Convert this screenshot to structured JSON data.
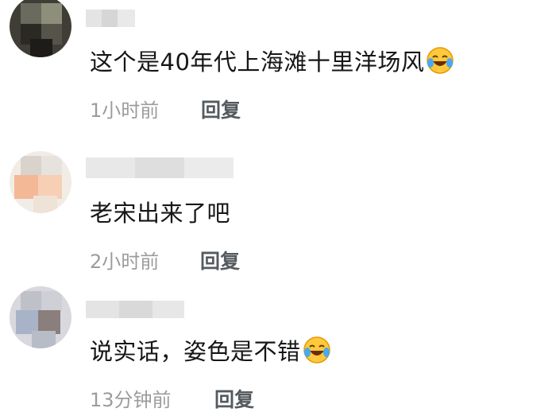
{
  "comments": [
    {
      "text": "这个是40年代上海滩十里洋场风",
      "emoji": "laughing-crying-emoji",
      "time": "1小时前",
      "reply_label": "回复"
    },
    {
      "text": "老宋出来了吧",
      "time": "2小时前",
      "reply_label": "回复"
    },
    {
      "text": "说实话，姿色是不错",
      "emoji": "laughing-crying-emoji",
      "time": "13分钟前",
      "reply_label": "回复"
    }
  ],
  "colors": {
    "meta_text": "#9c9c9c",
    "reply_text": "#555a5f",
    "body_text": "#161616"
  }
}
